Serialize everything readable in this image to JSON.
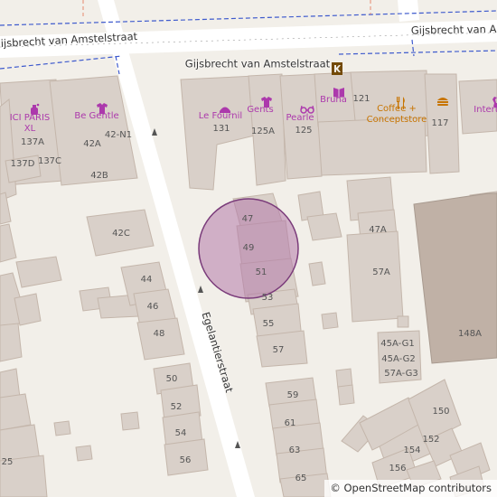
{
  "map": {
    "streets": {
      "top": "Gijsbrecht van Amstelstraat",
      "side": "Egelantierstraat"
    },
    "shops": {
      "ici_paris": "ICI PARIS XL",
      "be_gentle": "Be Gentle",
      "le_fournil": "Le Fournil",
      "gents": "Gents",
      "pearle": "Pearle",
      "bruna": "Bruna",
      "coffee": "Coffee + Conceptstore",
      "intertoys": "Intert"
    },
    "housenumbers": {
      "n137a": "137A",
      "n137d": "137D",
      "n137c": "137C",
      "n42a": "42A",
      "n42n1": "42-N1",
      "n42b": "42B",
      "n131": "131",
      "n125a": "125A",
      "n125": "125",
      "n121": "121",
      "n117": "117",
      "n42c": "42C",
      "n44": "44",
      "n46": "46",
      "n48": "48",
      "n50": "50",
      "n52": "52",
      "n54": "54",
      "n56": "56",
      "n25": "25",
      "n47": "47",
      "n49": "49",
      "n51": "51",
      "n53": "53",
      "n55": "55",
      "n57": "57",
      "n59": "59",
      "n61": "61",
      "n63": "63",
      "n65": "65",
      "n47a": "47A",
      "n57a": "57A",
      "n45ag1": "45A-G1",
      "n45ag2": "45A-G2",
      "n57ag3": "57A-G3",
      "n148a": "148A",
      "n150": "150",
      "n152": "152",
      "n154": "154",
      "n156": "156"
    },
    "icons": {
      "perfume": "perfume-icon",
      "clothes": "clothes-icon",
      "bakery": "bakery-icon",
      "optician": "optician-icon",
      "books": "books-icon",
      "cafe": "cafe-icon",
      "fastfood": "fastfood-icon",
      "toys": "toys-icon",
      "bookmaker": "bookmaker-icon"
    },
    "colors": {
      "background": "#f2efe9",
      "building": "#d9d0c9",
      "building_outline": "#c4b6ab",
      "road": "#ffffff",
      "shop": "#ac39ac",
      "cafe": "#c77400",
      "highlight": "#b47aaa"
    },
    "highlight": {
      "type": "circle",
      "house": "49"
    },
    "attribution": "© OpenStreetMap contributors"
  }
}
